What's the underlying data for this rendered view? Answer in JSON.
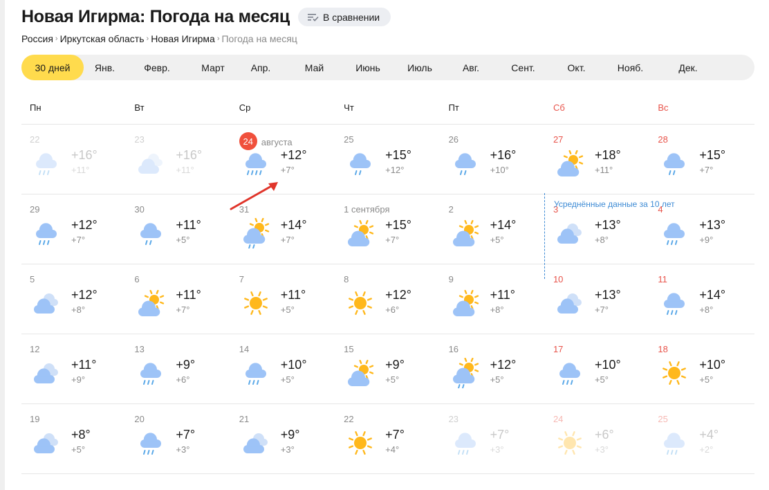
{
  "page": {
    "title": "Новая Игирма: Погода на месяц",
    "compare_button": {
      "label": "В сравнении",
      "icon": "compare-list-icon"
    }
  },
  "breadcrumb": [
    {
      "label": "Россия"
    },
    {
      "label": "Иркутская область"
    },
    {
      "label": "Новая Игирма"
    },
    {
      "label": "Погода на месяц",
      "current": true
    }
  ],
  "breadcrumb_separator": "›",
  "month_tabs": [
    {
      "label": "30 дней",
      "active": true
    },
    {
      "label": "Янв."
    },
    {
      "label": "Февр."
    },
    {
      "label": "Март"
    },
    {
      "label": "Апр."
    },
    {
      "label": "Май"
    },
    {
      "label": "Июнь"
    },
    {
      "label": "Июль"
    },
    {
      "label": "Авг."
    },
    {
      "label": "Сент."
    },
    {
      "label": "Окт."
    },
    {
      "label": "Нояб."
    },
    {
      "label": "Дек."
    }
  ],
  "weekdays": [
    {
      "label": "Пн"
    },
    {
      "label": "Вт"
    },
    {
      "label": "Ср"
    },
    {
      "label": "Чт"
    },
    {
      "label": "Пт"
    },
    {
      "label": "Сб",
      "weekend": true
    },
    {
      "label": "Вс",
      "weekend": true
    }
  ],
  "averaged_note": "Усреднённые данные за 10 лет",
  "today": {
    "day": "24",
    "month": "августа"
  },
  "colors": {
    "accent": "#ffdb4d",
    "weekend": "#e8534a",
    "today_badge": "#f0503c",
    "avg_note": "#3c8ad4",
    "cloud": "#9dc3f7",
    "sun": "#ffb81c",
    "rain": "#5aa8e8"
  },
  "weeks": [
    [
      {
        "day": "22",
        "hi": "+16°",
        "lo": "+11°",
        "icon": "rain",
        "dim": true
      },
      {
        "day": "23",
        "hi": "+16°",
        "lo": "+11°",
        "icon": "overcast",
        "dim": true
      },
      {
        "day": "24",
        "hi": "+12°",
        "lo": "+7°",
        "icon": "heavy-rain",
        "today": true
      },
      {
        "day": "25",
        "hi": "+15°",
        "lo": "+12°",
        "icon": "light-rain"
      },
      {
        "day": "26",
        "hi": "+16°",
        "lo": "+10°",
        "icon": "light-rain"
      },
      {
        "day": "27",
        "hi": "+18°",
        "lo": "+11°",
        "icon": "partly-cloudy",
        "weekend": true
      },
      {
        "day": "28",
        "hi": "+15°",
        "lo": "+7°",
        "icon": "light-rain",
        "weekend": true
      }
    ],
    [
      {
        "day": "29",
        "hi": "+12°",
        "lo": "+7°",
        "icon": "rain"
      },
      {
        "day": "30",
        "hi": "+11°",
        "lo": "+5°",
        "icon": "light-rain"
      },
      {
        "day": "31",
        "hi": "+14°",
        "lo": "+7°",
        "icon": "partly-cloudy-rain"
      },
      {
        "day": "1 сентября",
        "hi": "+15°",
        "lo": "+7°",
        "icon": "partly-cloudy"
      },
      {
        "day": "2",
        "hi": "+14°",
        "lo": "+5°",
        "icon": "partly-cloudy"
      },
      {
        "day": "3",
        "hi": "+13°",
        "lo": "+8°",
        "icon": "overcast",
        "weekend": true
      },
      {
        "day": "4",
        "hi": "+13°",
        "lo": "+9°",
        "icon": "rain",
        "weekend": true
      }
    ],
    [
      {
        "day": "5",
        "hi": "+12°",
        "lo": "+8°",
        "icon": "overcast"
      },
      {
        "day": "6",
        "hi": "+11°",
        "lo": "+7°",
        "icon": "partly-cloudy"
      },
      {
        "day": "7",
        "hi": "+11°",
        "lo": "+5°",
        "icon": "sunny"
      },
      {
        "day": "8",
        "hi": "+12°",
        "lo": "+6°",
        "icon": "sunny"
      },
      {
        "day": "9",
        "hi": "+11°",
        "lo": "+8°",
        "icon": "partly-cloudy"
      },
      {
        "day": "10",
        "hi": "+13°",
        "lo": "+7°",
        "icon": "overcast",
        "weekend": true
      },
      {
        "day": "11",
        "hi": "+14°",
        "lo": "+8°",
        "icon": "rain",
        "weekend": true
      }
    ],
    [
      {
        "day": "12",
        "hi": "+11°",
        "lo": "+9°",
        "icon": "overcast"
      },
      {
        "day": "13",
        "hi": "+9°",
        "lo": "+6°",
        "icon": "rain"
      },
      {
        "day": "14",
        "hi": "+10°",
        "lo": "+5°",
        "icon": "rain"
      },
      {
        "day": "15",
        "hi": "+9°",
        "lo": "+5°",
        "icon": "partly-cloudy"
      },
      {
        "day": "16",
        "hi": "+12°",
        "lo": "+5°",
        "icon": "partly-cloudy-rain"
      },
      {
        "day": "17",
        "hi": "+10°",
        "lo": "+5°",
        "icon": "rain",
        "weekend": true
      },
      {
        "day": "18",
        "hi": "+10°",
        "lo": "+5°",
        "icon": "sunny",
        "weekend": true
      }
    ],
    [
      {
        "day": "19",
        "hi": "+8°",
        "lo": "+5°",
        "icon": "overcast"
      },
      {
        "day": "20",
        "hi": "+7°",
        "lo": "+3°",
        "icon": "rain"
      },
      {
        "day": "21",
        "hi": "+9°",
        "lo": "+3°",
        "icon": "overcast"
      },
      {
        "day": "22",
        "hi": "+7°",
        "lo": "+4°",
        "icon": "sunny"
      },
      {
        "day": "23",
        "hi": "+7°",
        "lo": "+3°",
        "icon": "rain",
        "dim": true
      },
      {
        "day": "24",
        "hi": "+6°",
        "lo": "+3°",
        "icon": "sunny",
        "dim": true,
        "weekend": true
      },
      {
        "day": "25",
        "hi": "+4°",
        "lo": "+2°",
        "icon": "rain",
        "dim": true,
        "weekend": true
      }
    ]
  ]
}
